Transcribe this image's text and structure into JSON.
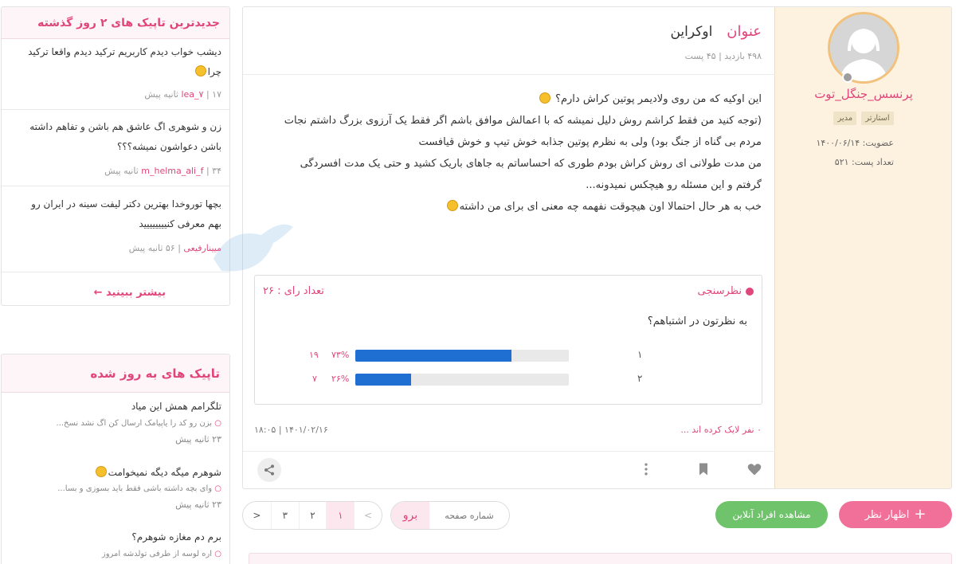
{
  "post": {
    "title_key": "عنوان",
    "title_value": "اوکراین",
    "views": "۴۹۸ بازدید",
    "posts": "۴۵ پست",
    "meta_sep": "|",
    "body": [
      "این اوکیه که من روی ولادیمر پوتین کراش دارم؟",
      "(توجه کنید من فقط کراشم روش دلیل نمیشه که با اعمالش موافق باشم اگر فقط یک آرزوی بزرگ داشتم نجات",
      "مردم بی گناه از جنگ بود) ولی به نظرم پوتین جذابه خوش تیپ و خوش قیافست",
      "من مدت طولانی ای روش کراش بودم طوری که احساساتم به جاهای باریک کشید و حتی یک مدت افسردگی",
      "گرفتم و این مسئله رو هیچکس نمیدونه...",
      "خب به هر حال احتمالا اون هیچوقت نفهمه چه معنی ای برای من داشته"
    ],
    "likes_text": "۰ نفر لایک کرده اند ...",
    "date_text": "۱۴۰۱/۰۲/۱۶ | ۱۸:۰۵"
  },
  "author": {
    "name": "پرنسس_جنگل_توت",
    "badges": [
      "مدیر",
      "استارتر"
    ],
    "member_label": "عضویت:",
    "member_value": "۱۴۰۰/۰۶/۱۴",
    "posts_label": "تعداد پست:",
    "posts_value": "۵۲۱"
  },
  "poll": {
    "label": "نظرسنجی",
    "votes_text": "تعداد رای : ۲۶",
    "question": "به نظرتون در اشتباهم؟",
    "options": [
      {
        "label": "۱",
        "percent_text": "۷۳%",
        "count": "۱۹",
        "fraction": 0.73
      },
      {
        "label": "۲",
        "percent_text": "۲۶%",
        "count": "۷",
        "fraction": 0.26
      }
    ]
  },
  "actions": {
    "icons": [
      "heart-icon",
      "bookmark-icon",
      "more-vertical-icon",
      "share-icon"
    ]
  },
  "controls": {
    "comment_label": "اظهار نظر",
    "online_label": "مشاهده افراد آنلاین",
    "goto_button": "برو",
    "goto_placeholder": "شماره صفحه",
    "pages": [
      "<",
      "۱",
      "۲",
      "۳",
      ">"
    ]
  },
  "latest": {
    "header": "جدیدترین تاپیک های ۲ روز گذشته",
    "items": [
      {
        "title1": "دیشب خواب دیدم کاربریم ترکید دیدم واقعا ترکید",
        "title2": "چرا",
        "user": "lea_۷",
        "time": "۱۷ ثانیه پیش"
      },
      {
        "title1": "زن و شوهری اگ عاشق هم باشن و تفاهم داشته",
        "title2": "باشن دعواشون نمیشه؟؟؟",
        "user": "m_helma_ali_f",
        "time": "۳۴ ثانیه پیش"
      },
      {
        "title1": "بچها توروخدا بهترین دکتر لیفت سینه در ایران رو",
        "title2": "بهم معرفی کنیییییییید",
        "user": "میینارفیعی",
        "time": "۵۶ ثانیه پیش"
      }
    ],
    "more": "بیشتر ببینید"
  },
  "updated": {
    "header": "تاپیک های به روز شده",
    "items": [
      {
        "title": "تلگرامم همش این میاد",
        "snippet": "بزن رو کد را یاپیامک ارسال کن اگ نشد نسخ...",
        "time": "۲۳ ثانیه پیش"
      },
      {
        "title": "شوهرم میگه دیگه نمیخوامت",
        "snippet": "وای بچه داشته باشی فقط باید بسوزی و بسا...",
        "time": "۲۳ ثانیه پیش"
      },
      {
        "title": "برم دم مغازه شوهرم؟",
        "snippet": "اره لوسه از طرفی تولدشه امروز",
        "time": ""
      }
    ]
  },
  "colors": {
    "accent": "#e0457b",
    "author_bg": "#fdf1df",
    "poll_bar": "#1f6fd3",
    "comment_btn": "#f0709a",
    "online_btn": "#6fc36b"
  }
}
